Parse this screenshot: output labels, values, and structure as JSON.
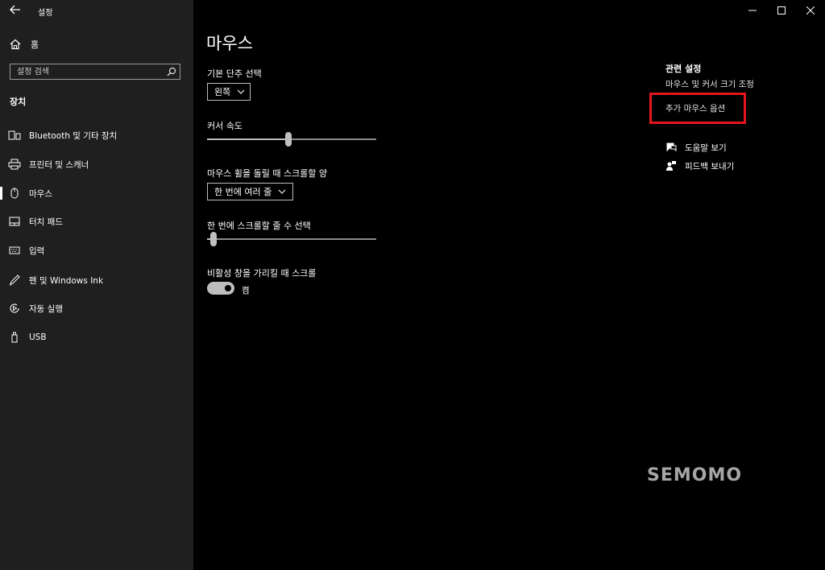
{
  "window": {
    "title": "설정",
    "back_icon": "back-arrow-icon",
    "controls": [
      "minimize-icon",
      "maximize-icon",
      "close-icon"
    ]
  },
  "sidebar": {
    "home_label": "홈",
    "search_placeholder": "설정 검색",
    "section_title": "장치",
    "items": [
      {
        "label": "Bluetooth 및 기타 장치",
        "icon": "bluetooth-devices-icon"
      },
      {
        "label": "프린터 및 스캐너",
        "icon": "printer-icon"
      },
      {
        "label": "마우스",
        "icon": "mouse-icon",
        "selected": true
      },
      {
        "label": "터치 패드",
        "icon": "touchpad-icon"
      },
      {
        "label": "입력",
        "icon": "keyboard-icon"
      },
      {
        "label": "펜 및 Windows Ink",
        "icon": "pen-icon"
      },
      {
        "label": "자동 실행",
        "icon": "autoplay-icon"
      },
      {
        "label": "USB",
        "icon": "usb-icon"
      }
    ]
  },
  "main": {
    "title": "마우스",
    "primary_button": {
      "label": "기본 단추 선택",
      "value": "왼쪽"
    },
    "cursor_speed": {
      "label": "커서 속도",
      "value_fraction": 0.48
    },
    "wheel_scroll": {
      "label": "마우스 휠을 돌릴 때 스크롤할 양",
      "value": "한 번에 여러 줄"
    },
    "lines_to_scroll": {
      "label": "한 번에 스크롤할 줄 수 선택",
      "value_fraction": 0.02
    },
    "inactive_scroll": {
      "label": "비활성 창을 가리킬 때 스크롤",
      "state": "켬",
      "on": true
    }
  },
  "related": {
    "title": "관련 설정",
    "links": [
      "마우스 및 커서 크기 조정",
      "추가 마우스 옵션"
    ],
    "help": [
      {
        "label": "도움말 보기",
        "icon": "help-chat-icon"
      },
      {
        "label": "피드백 보내기",
        "icon": "feedback-icon"
      }
    ]
  },
  "watermark": "SEMOMO",
  "colors": {
    "highlight": "#e3171d",
    "sidebar_bg": "#1f1f1f",
    "main_bg": "#000000"
  }
}
